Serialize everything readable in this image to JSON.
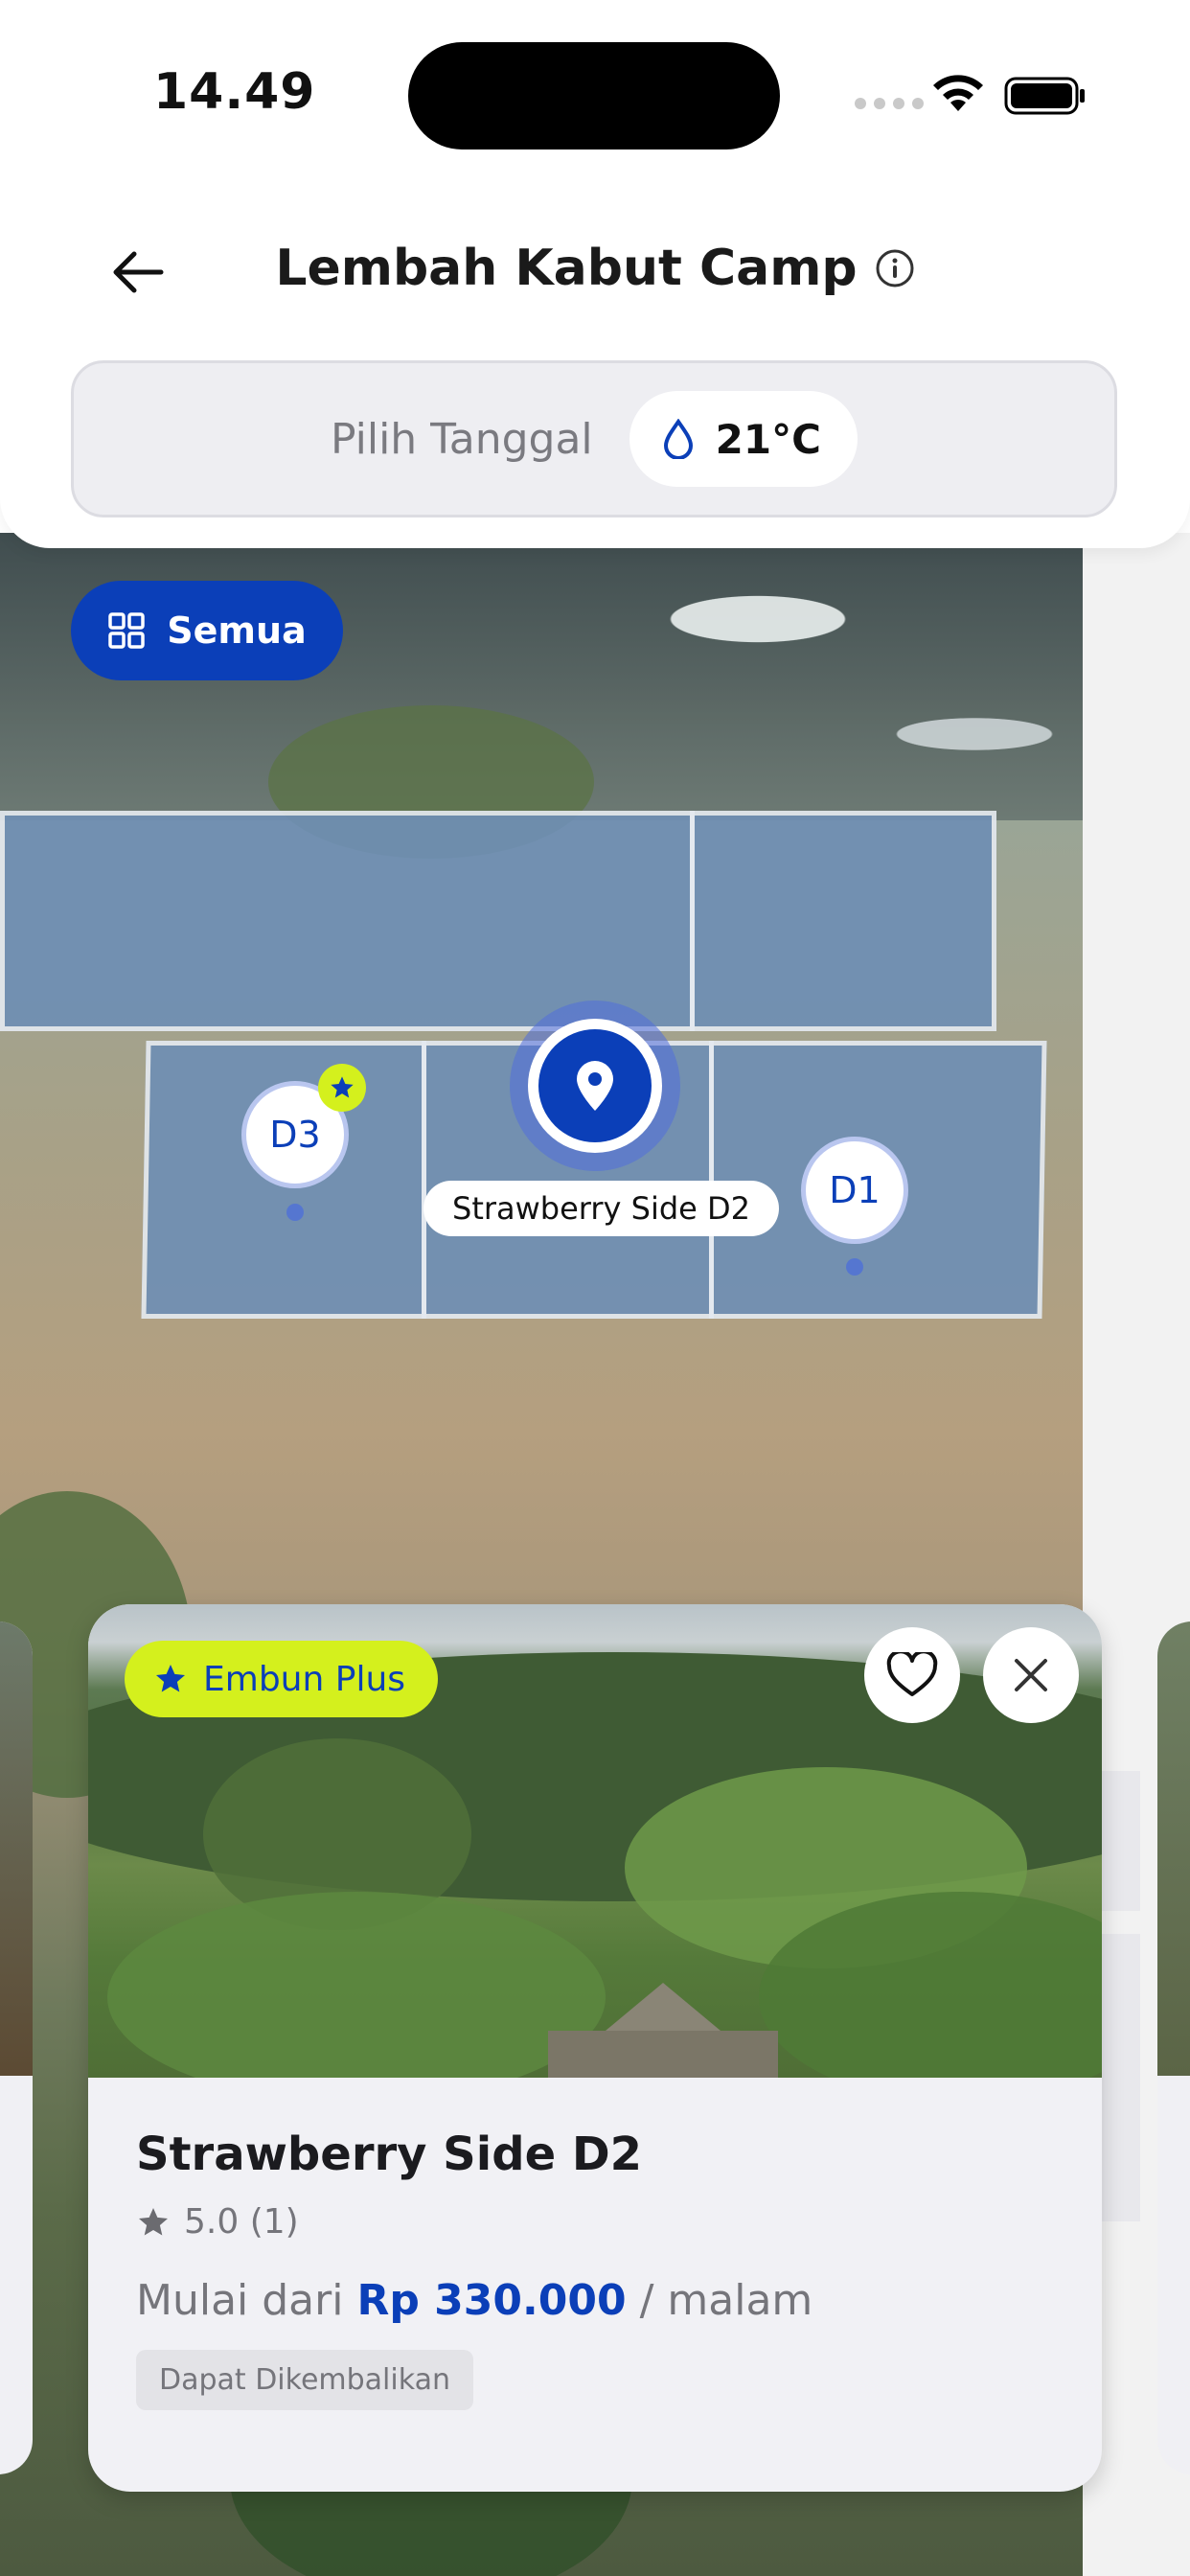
{
  "status_bar": {
    "time": "14.49"
  },
  "header": {
    "title": "Lembah Kabut Camp",
    "date_placeholder": "Pilih Tanggal",
    "temperature": "21°C"
  },
  "map": {
    "filter_label": "Semua",
    "pins": [
      {
        "label": "D3",
        "featured": true
      },
      {
        "label": "D1",
        "featured": false
      }
    ],
    "selected_pin_label": "Strawberry Side D2"
  },
  "card": {
    "badge": "Embun Plus",
    "name": "Strawberry Side D2",
    "rating": "5.0 (1)",
    "price_prefix": "Mulai dari",
    "price": "Rp 330.000",
    "price_suffix": "/ malam",
    "tag": "Dapat Dikembalikan"
  },
  "colors": {
    "primary": "#0b3fb8",
    "accent": "#d4f01d",
    "muted_text": "#75757b"
  }
}
